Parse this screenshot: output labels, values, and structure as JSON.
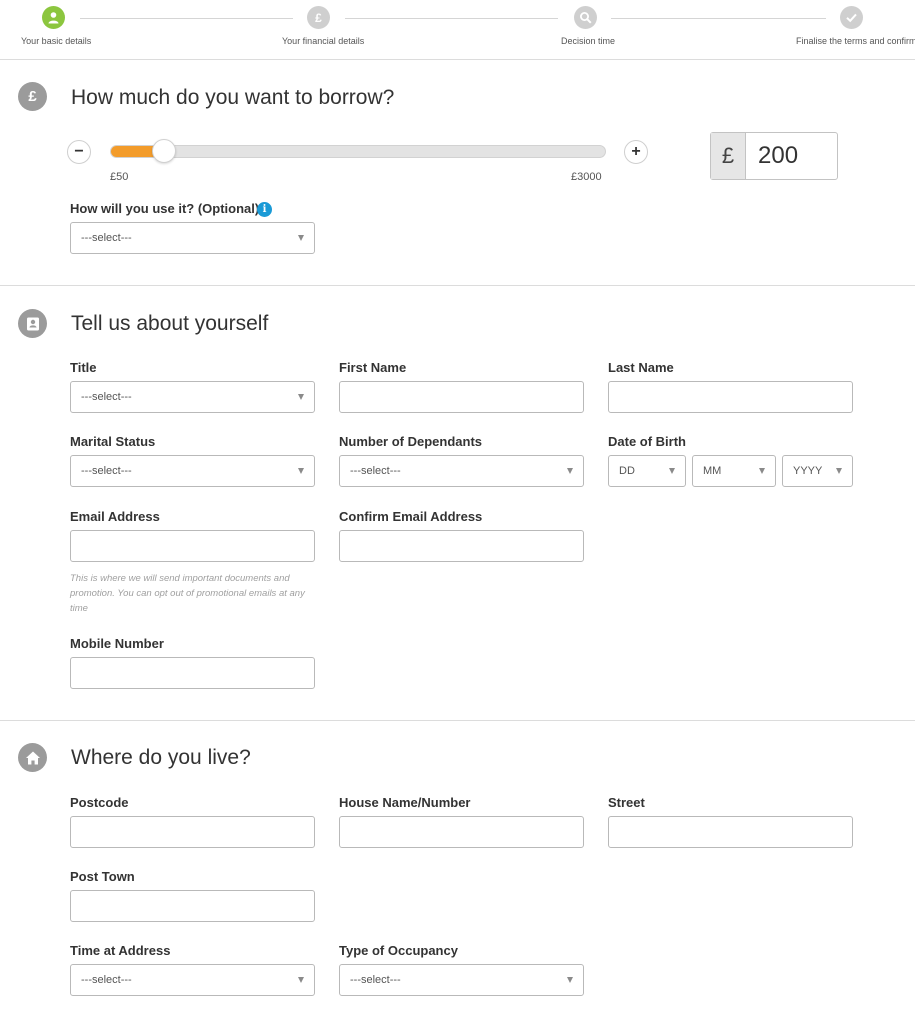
{
  "colors": {
    "active_step": "#8cc63f",
    "inactive_step": "#cfcfcf",
    "slider_fill": "#f39c2b",
    "info": "#1a9ad6",
    "section_icon": "#9b9b9b"
  },
  "stepper": {
    "steps": [
      {
        "label": "Your basic details",
        "icon": "user-icon",
        "active": true
      },
      {
        "label": "Your financial details",
        "icon": "pound-icon",
        "active": false
      },
      {
        "label": "Decision time",
        "icon": "search-icon",
        "active": false
      },
      {
        "label": "Finalise the terms and confirm",
        "icon": "check-icon",
        "active": false
      }
    ]
  },
  "borrow": {
    "icon": "pound-icon",
    "title": "How much do you want to borrow?",
    "minus_label": "−",
    "plus_label": "+",
    "min_label": "£50",
    "max_label": "£3000",
    "min_value": 50,
    "max_value": 3000,
    "current_value": 200,
    "currency_symbol": "£",
    "amount": "200",
    "use_label": "How will you use it? (Optional)",
    "info_glyph": "i",
    "use_select": "---select---"
  },
  "about": {
    "icon": "contact-card-icon",
    "title": "Tell us about yourself",
    "title_label": "Title",
    "title_select": "---select---",
    "first_name_label": "First Name",
    "first_name_value": "",
    "last_name_label": "Last Name",
    "last_name_value": "",
    "marital_label": "Marital Status",
    "marital_select": "---select---",
    "dependants_label": "Number of Dependants",
    "dependants_select": "---select---",
    "dob_label": "Date of Birth",
    "dob_day": "DD",
    "dob_month": "MM",
    "dob_year": "YYYY",
    "email_label": "Email Address",
    "email_value": "",
    "confirm_email_label": "Confirm Email Address",
    "confirm_email_value": "",
    "email_hint": "This is where we will send important documents and promotion. You can opt out of promotional emails at any time",
    "mobile_label": "Mobile Number",
    "mobile_value": ""
  },
  "address": {
    "icon": "home-icon",
    "title": "Where do you live?",
    "postcode_label": "Postcode",
    "postcode_value": "",
    "house_label": "House Name/Number",
    "house_value": "",
    "street_label": "Street",
    "street_value": "",
    "post_town_label": "Post Town",
    "post_town_value": "",
    "time_label": "Time at Address",
    "time_select": "---select---",
    "occupancy_label": "Type of Occupancy",
    "occupancy_select": "---select---"
  }
}
